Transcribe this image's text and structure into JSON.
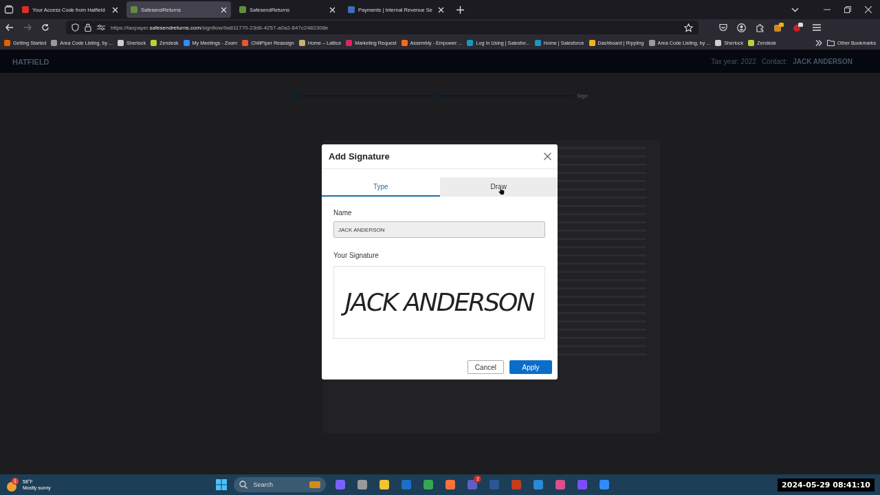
{
  "browser": {
    "tabs": [
      {
        "title": "Your Access Code from Hatfield",
        "selected": false,
        "color": "#d93025"
      },
      {
        "title": "SafesendReturns",
        "selected": true,
        "color": "#5f8f3e"
      },
      {
        "title": "SafesendReturns",
        "selected": false,
        "color": "#5f8f3e"
      },
      {
        "title": "Payments | Internal Revenue Se",
        "selected": false,
        "color": "#3b6fb6"
      }
    ],
    "url": {
      "prefix": "https://taxpayer.",
      "domain": "safesendreturns.com",
      "path": "/signflow/9a811770-23d6-4257-a0a2-847c2482308e"
    },
    "bookmarks": [
      {
        "label": "Getting Started",
        "color": "#e66000"
      },
      {
        "label": "Area Code Listing, by ...",
        "color": "#9a9a9a"
      },
      {
        "label": "Sherlock",
        "color": "#cfcfcf"
      },
      {
        "label": "Zendesk",
        "color": "#b6d43a"
      },
      {
        "label": "My Meetings - Zoom",
        "color": "#2d8cff"
      },
      {
        "label": "ChiliPiper Reassign",
        "color": "#e8572a"
      },
      {
        "label": "Home – Lattice",
        "color": "#c9b26b"
      },
      {
        "label": "Marketing Request",
        "color": "#e0245e"
      },
      {
        "label": "Assembly - Empower ...",
        "color": "#ff6a13"
      },
      {
        "label": "Log In Using | Salesfor...",
        "color": "#1798c1"
      },
      {
        "label": "Home | Salesforce",
        "color": "#1798c1"
      },
      {
        "label": "Dashboard | Rippling",
        "color": "#f2b31a"
      },
      {
        "label": "Area Code Listing, by ...",
        "color": "#9a9a9a"
      },
      {
        "label": "Sherlock",
        "color": "#cfcfcf"
      },
      {
        "label": "Zendesk",
        "color": "#b6d43a"
      }
    ],
    "other_bookmarks": "Other Bookmarks"
  },
  "page": {
    "logo": "HATFIELD",
    "tax_year": "Tax year: 2022",
    "contact_label": "Contact:",
    "contact_name": "JACK ANDERSON",
    "step": "Sign"
  },
  "dialog": {
    "title": "Add Signature",
    "tabs": [
      {
        "label": "Type",
        "selected": true
      },
      {
        "label": "Draw",
        "selected": false
      }
    ],
    "name_label": "Name",
    "name_value": "JACK ANDERSON",
    "signature_label": "Your Signature",
    "signature": "JACK ANDERSON",
    "buttons": [
      {
        "label": "Cancel",
        "kind": "secondary"
      },
      {
        "label": "Apply",
        "kind": "primary"
      }
    ]
  },
  "taskbar": {
    "weather_badge": "1",
    "temperature": "58°F",
    "weather": "Mostly sunny",
    "search": "Search",
    "apps": [
      {
        "color": "#7b61ff"
      },
      {
        "color": "#9a9a9a"
      },
      {
        "color": "#f2c230"
      },
      {
        "color": "#1f6fc9"
      },
      {
        "color": "#34a853"
      },
      {
        "color": "#ff7139"
      },
      {
        "color": "#5b5fc7",
        "badge": "2"
      },
      {
        "color": "#2b5797"
      },
      {
        "color": "#c43e1c"
      },
      {
        "color": "#2a8ad4"
      },
      {
        "color": "#d94f8b"
      },
      {
        "color": "#7c4dff"
      },
      {
        "color": "#2d8cff"
      }
    ]
  },
  "recording_time": "2024-05-29 08:41:10"
}
